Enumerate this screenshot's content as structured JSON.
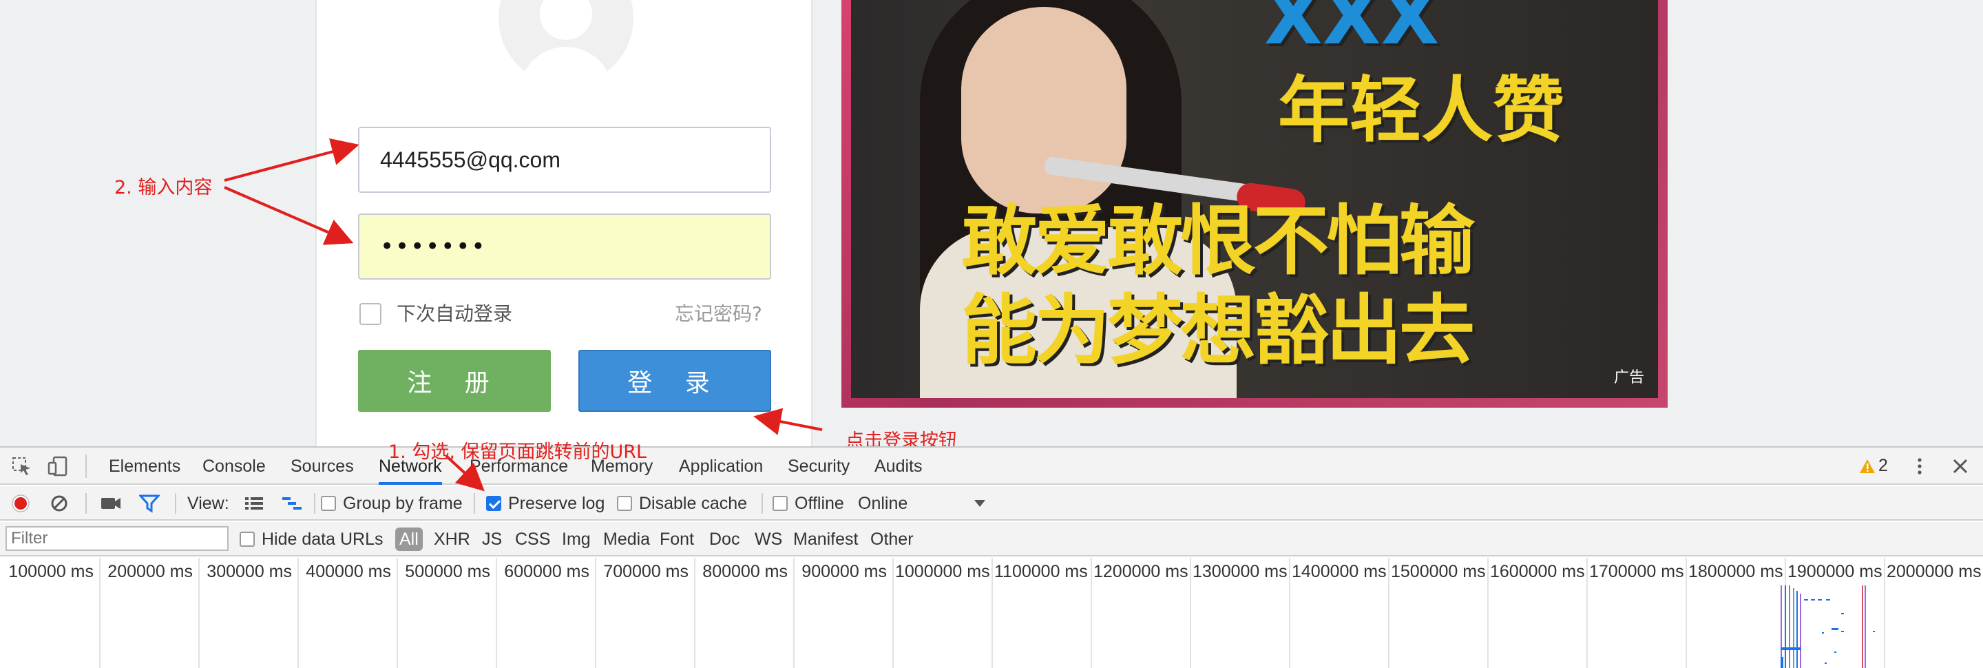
{
  "login": {
    "email_value": "4445555@qq.com",
    "password_value": "•••••••",
    "remember_label": "下次自动登录",
    "forgot_label": "忘记密码?",
    "register_label": "注 册",
    "login_label": "登 录"
  },
  "ad": {
    "line_0": "XXX",
    "line_1": "年轻人赞",
    "line_2": "敢爱敢恨不怕输",
    "line_3": "能为梦想豁出去",
    "tag": "广告"
  },
  "annotations": {
    "input_note": "2. 输入内容",
    "click_note": "点击登录按钮",
    "preserve_note": "1. 勾选, 保留页面跳转前的URL"
  },
  "devtools": {
    "tabs": [
      "Elements",
      "Console",
      "Sources",
      "Network",
      "Performance",
      "Memory",
      "Application",
      "Security",
      "Audits"
    ],
    "active_tab": "Network",
    "warning_count": "2",
    "toolbar": {
      "view_label": "View:",
      "group_by_frame": "Group by frame",
      "preserve_log": "Preserve log",
      "preserve_log_checked": true,
      "disable_cache": "Disable cache",
      "offline": "Offline",
      "throttling": "Online"
    },
    "filter": {
      "placeholder": "Filter",
      "hide_data_urls": "Hide data URLs",
      "types": [
        "All",
        "XHR",
        "JS",
        "CSS",
        "Img",
        "Media",
        "Font",
        "Doc",
        "WS",
        "Manifest",
        "Other"
      ]
    },
    "timeline_ticks": [
      "100000 ms",
      "200000 ms",
      "300000 ms",
      "400000 ms",
      "500000 ms",
      "600000 ms",
      "700000 ms",
      "800000 ms",
      "900000 ms",
      "1000000 ms",
      "1100000 ms",
      "1200000 ms",
      "1300000 ms",
      "1400000 ms",
      "1500000 ms",
      "1600000 ms",
      "1700000 ms",
      "1800000 ms",
      "1900000 ms",
      "2000000 ms"
    ]
  },
  "colors": {
    "annotation": "#e0201d",
    "register_green": "#6fb160",
    "login_blue": "#3d8fd9",
    "active_tab_blue": "#1a73e8",
    "record_red": "#e0201d"
  },
  "icons": [
    "inspect-icon",
    "device-icon",
    "warning-icon",
    "kebab-icon",
    "close-icon",
    "record-icon",
    "clear-icon",
    "camera-icon",
    "filter-icon",
    "list-view-icon",
    "waterfall-view-icon",
    "dropdown-icon"
  ]
}
